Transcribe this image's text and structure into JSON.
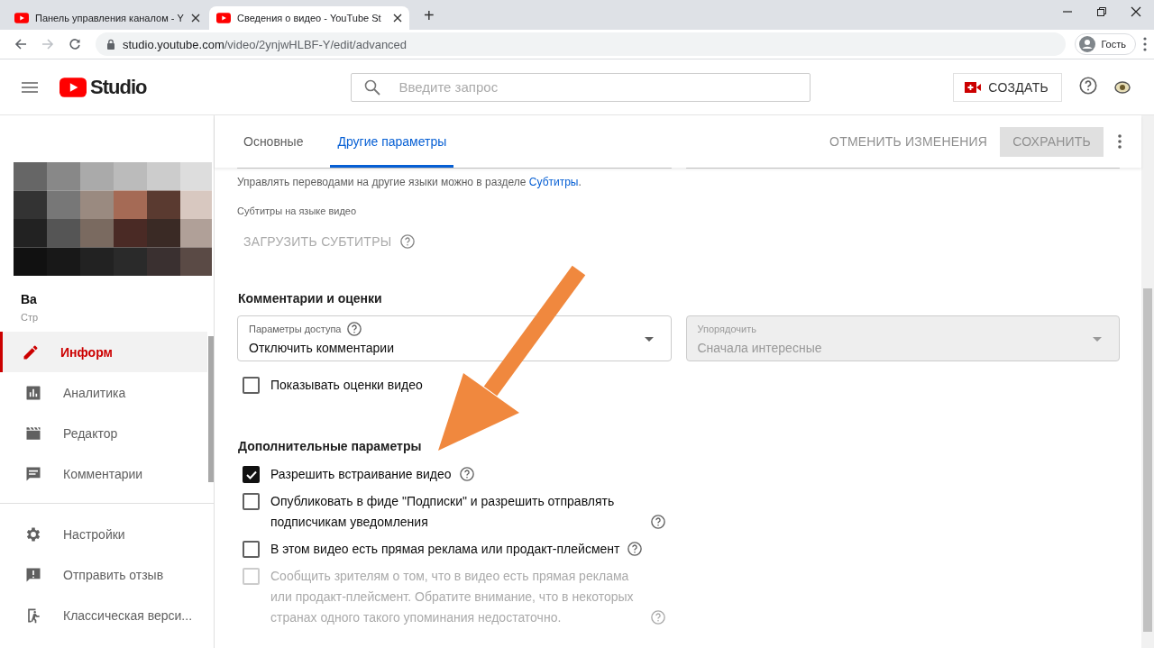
{
  "browser": {
    "tabs": [
      {
        "title": "Панель управления каналом - Y",
        "selected": false
      },
      {
        "title": "Сведения о видео - YouTube St",
        "selected": true
      }
    ],
    "new_tab": "+",
    "url": "studio.youtube.com/video/2ynjwHLBF-Y/edit/advanced",
    "profile": "Гость"
  },
  "header": {
    "logo": "Studio",
    "search": {
      "placeholder": "Введите запрос"
    },
    "create_button": "СОЗДАТЬ"
  },
  "sidebar": {
    "channel": {
      "name": "Ва",
      "subtitle": "Стр"
    },
    "items": [
      {
        "label": "Информ",
        "kind": "pencil",
        "selected": true
      },
      {
        "label": "Аналитика",
        "kind": "analytics",
        "selected": false
      },
      {
        "label": "Редактор",
        "kind": "clapper",
        "selected": false
      },
      {
        "label": "Комментарии",
        "kind": "comment",
        "selected": false
      }
    ],
    "footer_items": [
      {
        "label": "Настройки",
        "kind": "gear",
        "selected": false
      },
      {
        "label": "Отправить отзыв",
        "kind": "feedback",
        "selected": false
      },
      {
        "label": "Классическая верси...",
        "kind": "exit",
        "selected": false
      }
    ]
  },
  "editor": {
    "tabs": [
      {
        "label": "Основные",
        "selected": false
      },
      {
        "label": "Другие параметры",
        "selected": true
      }
    ],
    "discard_button": "ОТМЕНИТЬ ИЗМЕНЕНИЯ",
    "save_button": {
      "label": "СОХРАНИТЬ",
      "disabled": true
    },
    "translations_note": {
      "text": "Управлять переводами на другие языки можно в разделе ",
      "link": "Субтитры",
      "end": "."
    },
    "subtitles_label": "Субтитры на языке видео",
    "upload_button": {
      "label": "ЗАГРУЗИТЬ СУБТИТРЫ",
      "disabled": true
    },
    "comments": {
      "title": "Комментарии и оценки",
      "selects": [
        {
          "label": "Параметры доступа",
          "value": "Отключить комментарии",
          "help": true,
          "disabled": false
        },
        {
          "label": "Упорядочить",
          "value": "Сначала интересные",
          "help": false,
          "disabled": true
        }
      ],
      "checkboxes": [
        {
          "label": "Показывать оценки видео",
          "checked": false,
          "disabled": false,
          "help": false
        }
      ]
    },
    "advanced": {
      "title": "Дополнительные параметры",
      "checkboxes": [
        {
          "label": "Разрешить встраивание видео",
          "checked": true,
          "disabled": false,
          "help": true
        },
        {
          "label": "Опубликовать в фиде \"Подписки\" и разрешить отправлять подписчикам уведомления",
          "checked": false,
          "disabled": false,
          "help": true
        },
        {
          "label": "В этом видео есть прямая реклама или продакт-плейсмент",
          "checked": false,
          "disabled": false,
          "help": true
        },
        {
          "label": "Сообщить зрителям о том, что в видео есть прямая реклама или продакт-плейсмент. Обратите внимание, что в некоторых странах одного такого упоминания недостаточно.",
          "checked": false,
          "disabled": true,
          "help": true
        }
      ]
    }
  }
}
